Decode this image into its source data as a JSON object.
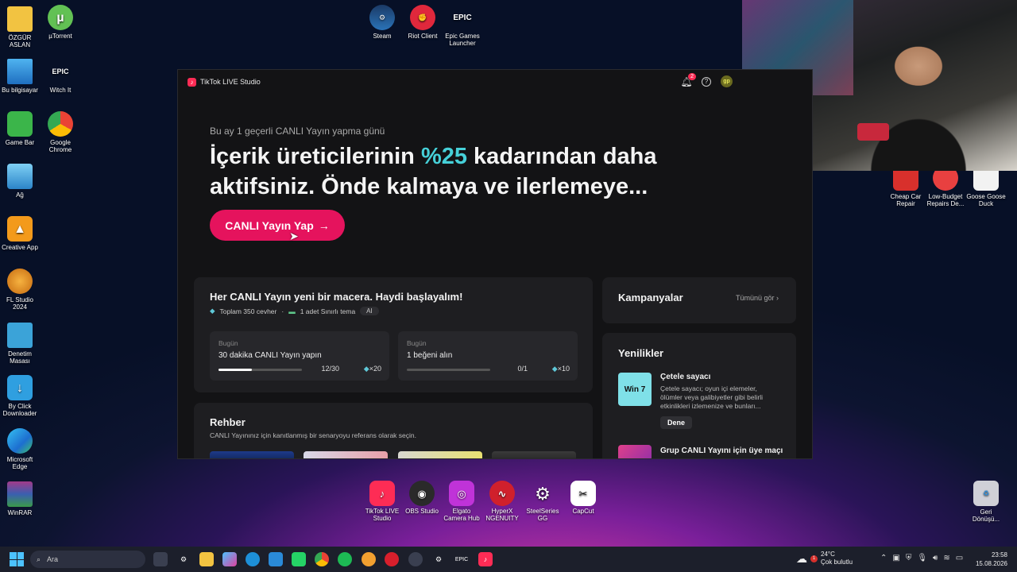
{
  "desktop": {
    "left_icons": [
      {
        "label": "ÖZGÜR ASLAN",
        "icon": "folder-icon"
      },
      {
        "label": "µTorrent",
        "icon": "utorrent-icon"
      },
      {
        "label": "Bu bilgisayar",
        "icon": "computer-icon"
      },
      {
        "label": "Witch It",
        "icon": "epic-games-icon"
      },
      {
        "label": "Game Bar",
        "icon": "game-bar-icon"
      },
      {
        "label": "Google Chrome",
        "icon": "chrome-icon"
      },
      {
        "label": "Ağ",
        "icon": "network-icon"
      },
      {
        "label": "Creative App",
        "icon": "creative-app-icon"
      },
      {
        "label": "FL Studio 2024",
        "icon": "fl-studio-icon"
      },
      {
        "label": "Denetim Masası",
        "icon": "control-panel-icon"
      },
      {
        "label": "By Click Downloader",
        "icon": "downloader-icon"
      },
      {
        "label": "Microsoft Edge",
        "icon": "edge-icon"
      },
      {
        "label": "WinRAR",
        "icon": "winrar-icon"
      }
    ],
    "top_icons": [
      {
        "label": "Steam",
        "icon": "steam-icon"
      },
      {
        "label": "Riot Client",
        "icon": "riot-icon"
      },
      {
        "label": "Epic Games Launcher",
        "icon": "epic-games-icon"
      }
    ],
    "right_icons": [
      {
        "label": "Cheap Car Repair",
        "icon": "car-repair-icon"
      },
      {
        "label": "Low-Budget Repairs De...",
        "icon": "repairs-icon"
      },
      {
        "label": "Goose Goose Duck",
        "icon": "goose-icon"
      },
      {
        "label": "Geri Dönüşü...",
        "icon": "recycle-bin-icon"
      }
    ],
    "dock_icons": [
      {
        "label": "TikTok LIVE Studio",
        "icon": "tiktok-live-icon"
      },
      {
        "label": "OBS Studio",
        "icon": "obs-icon"
      },
      {
        "label": "Elgato Camera Hub",
        "icon": "elgato-icon"
      },
      {
        "label": "HyperX NGENUITY",
        "icon": "hyperx-icon"
      },
      {
        "label": "SteelSeries GG",
        "icon": "steelseries-icon"
      },
      {
        "label": "CapCut",
        "icon": "capcut-icon"
      }
    ]
  },
  "window": {
    "title": "TikTok LIVE Studio",
    "notif_count": "2",
    "avatar_text": "gp",
    "hero": {
      "subtitle": "Bu ay 1 geçerli CANLI Yayın yapma günü",
      "title_pre": "İçerik üreticilerinin ",
      "title_accent": "%25",
      "title_post": " kadarından daha aktifsiniz. Önde kalmaya ve ilerlemeye...",
      "cta": "CANLI Yayın Yap",
      "cta_arrow": "→"
    },
    "mission": {
      "title": "Her CANLI Yayın yeni bir macera. Haydi başlayalım!",
      "gems": "Toplam 350 cevher",
      "sep": "·",
      "theme": "1 adet Sınırlı tema",
      "ai": "AI",
      "tasks": [
        {
          "day": "Bugün",
          "title": "30 dakika CANLI Yayın yapın",
          "progress_text": "12/30",
          "progress": 0.4,
          "reward": "×20"
        },
        {
          "day": "Bugün",
          "title": "1 beğeni alın",
          "progress_text": "0/1",
          "progress": 0,
          "reward": "×10"
        }
      ]
    },
    "campaigns": {
      "title": "Kampanyalar",
      "see_all": "Tümünü gör"
    },
    "news": {
      "title": "Yenilikler",
      "item1_thumb": "Win 7",
      "item1_title": "Çetele sayacı",
      "item1_desc": "Çetele sayacı; oyun içi elemeler, ölümler veya galibiyetler gibi belirli etkinlikleri izlemenize ve bunları...",
      "item1_button": "Dene",
      "item2_title": "Grup CANLI Yayını için üye maçı"
    },
    "guide": {
      "title": "Rehber",
      "desc": "CANLI Yayınınız için kanıtlanmış bir senaryoyu referans olarak seçin."
    }
  },
  "taskbar": {
    "search_placeholder": "Ara",
    "weather_temp": "24°C",
    "weather_desc": "Çok bulutlu",
    "weather_badge": "1",
    "time": "23:58",
    "date": "15.08.2026"
  },
  "colors": {
    "accent": "#e5135d",
    "highlight": "#46d0d8",
    "window_bg": "#131315",
    "card_bg": "#1e1e21"
  }
}
